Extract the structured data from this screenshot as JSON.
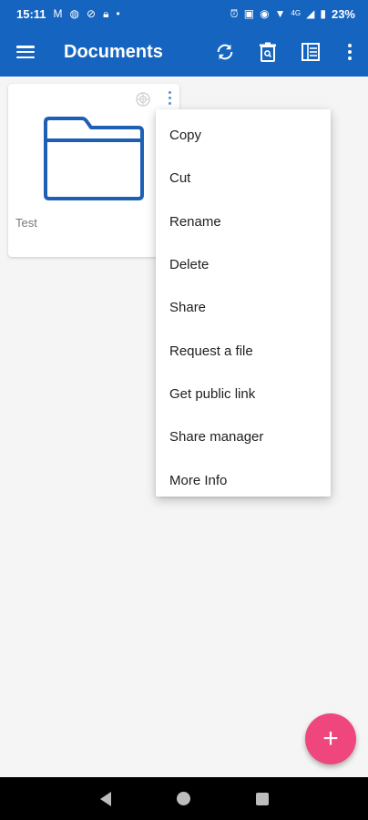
{
  "status": {
    "time": "15:11",
    "battery": "23%",
    "network": "4G"
  },
  "appbar": {
    "title": "Documents"
  },
  "colors": {
    "primary": "#1565c0",
    "accent": "#f0467e"
  },
  "folder": {
    "name": "Test"
  },
  "menu": {
    "items": [
      "Copy",
      "Cut",
      "Rename",
      "Delete",
      "Share",
      "Request a file",
      "Get public link",
      "Share manager",
      "More Info"
    ]
  },
  "fab": {
    "symbol": "+"
  },
  "icons": [
    "menu-icon",
    "sync-icon",
    "trash-icon",
    "list-view-icon",
    "overflow-menu-icon",
    "folder-icon",
    "offline-icon",
    "more-vert-icon",
    "add-icon",
    "back-icon",
    "home-icon",
    "recents-icon"
  ]
}
